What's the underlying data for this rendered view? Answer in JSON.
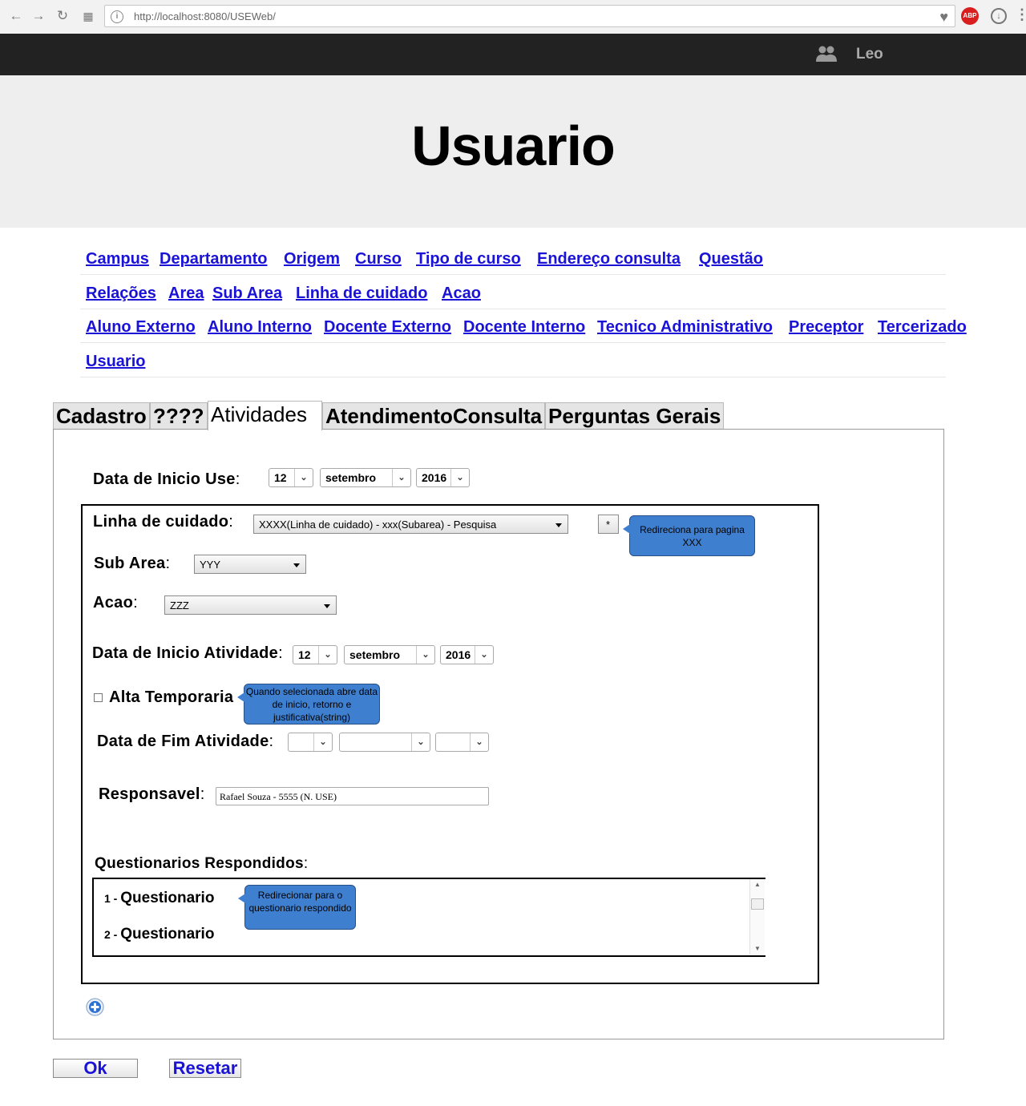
{
  "browser": {
    "url": "http://localhost:8080/USEWeb/"
  },
  "topbar": {
    "user_name": "Leo"
  },
  "header": {
    "title": "Usuario"
  },
  "nav": {
    "row1": [
      "Campus",
      "Departamento",
      "Origem",
      "Curso",
      "Tipo de curso",
      "Endereço consulta",
      "Questão"
    ],
    "row2": [
      "Relações",
      "Area",
      "Sub Area",
      "Linha de cuidado",
      "Acao"
    ],
    "row3": [
      "Aluno Externo",
      "Aluno Interno",
      "Docente Externo",
      "Docente Interno",
      "Tecnico Administrativo",
      "Preceptor",
      "Tercerizado"
    ],
    "row4": [
      "Usuario"
    ]
  },
  "tabs": [
    "Cadastro",
    "????",
    "Atividades",
    "AtendimentoConsulta",
    "Perguntas Gerais"
  ],
  "active_tab": "Atividades",
  "form": {
    "data_inicio_use_label": "Data de Inicio Use",
    "data_inicio_use": {
      "day": "12",
      "month": "setembro",
      "year": "2016"
    },
    "linha_label": "Linha de cuidado",
    "linha_value": "XXXX(Linha de cuidado) - xxx(Subarea) - Pesquisa",
    "star_button": "*",
    "callout_linha": "Redireciona para pagina XXX",
    "subarea_label": "Sub Area",
    "subarea_value": "YYY",
    "acao_label": "Acao",
    "acao_value": "ZZZ",
    "data_inicio_atividade_label": "Data de Inicio Atividade",
    "data_inicio_atividade": {
      "day": "12",
      "month": "setembro",
      "year": "2016"
    },
    "alta_label": "Alta Temporaria",
    "callout_alta": "Quando selecionada abre data de inicio, retorno e justificativa(string)",
    "data_fim_label": "Data de Fim Atividade",
    "data_fim": {
      "day": "",
      "month": "",
      "year": ""
    },
    "responsavel_label": "Responsavel",
    "responsavel_value": "Rafael Souza - 5555 (N. USE)",
    "questionarios_label": "Questionarios Respondidos",
    "questionarios": [
      {
        "num": "1",
        "label": "Questionario"
      },
      {
        "num": "2",
        "label": "Questionario"
      }
    ],
    "callout_quest": "Redirecionar para o questionario respondido"
  },
  "buttons": {
    "ok": "Ok",
    "reset": "Resetar"
  }
}
